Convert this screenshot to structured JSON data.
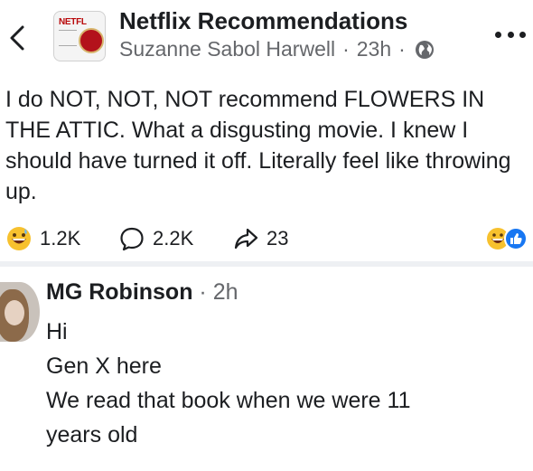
{
  "header": {
    "group_name": "Netflix Recommendations",
    "author": "Suzanne Sabol Harwell",
    "time": "23h",
    "separator": "·",
    "thumb_text": "NETFL"
  },
  "post": {
    "text": "I do NOT, NOT, NOT recommend FLOWERS IN THE ATTIC. What a disgusting movie. I knew I should have turned it off. Literally feel like throwing up."
  },
  "stats": {
    "reactions": "1.2K",
    "comments": "2.2K",
    "shares": "23"
  },
  "comment": {
    "name": "MG Robinson",
    "separator": " · ",
    "time": "2h",
    "lines": [
      "Hi",
      "Gen X here",
      "We read that book when we were 11",
      "years old"
    ]
  },
  "icons": {
    "back": "chevron-left-icon",
    "globe": "globe-icon",
    "more": "more-dots-icon",
    "reaction": "grinning-sweat-emoji-icon",
    "comment": "comment-bubble-icon",
    "share": "share-arrow-icon",
    "like": "like-thumb-icon"
  },
  "colors": {
    "text": "#1c1e21",
    "secondary_text": "#65676b",
    "like_blue": "#1877f2",
    "emoji_yellow": "#f7c12e",
    "divider": "#eef0f3"
  }
}
